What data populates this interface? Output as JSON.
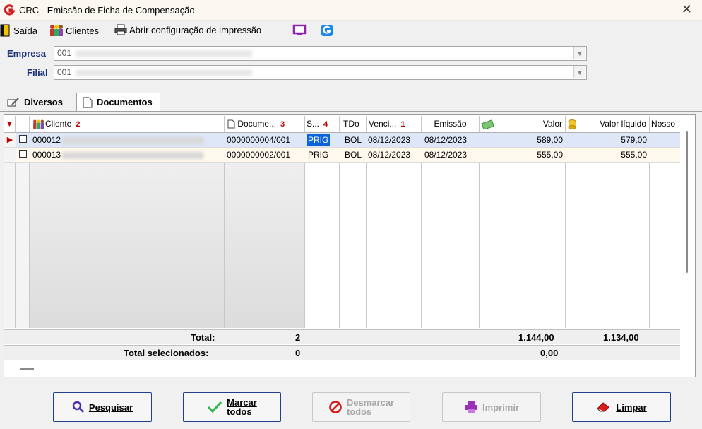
{
  "window": {
    "title": "CRC - Emissão de Ficha de Compensação",
    "close": "✕"
  },
  "menu": {
    "saida": "Saída",
    "clientes": "Clientes",
    "abrir": "Abrir configuração de impressão"
  },
  "form": {
    "empresa_label": "Empresa",
    "empresa_value": "001",
    "filial_label": "Filial",
    "filial_value": "001"
  },
  "tabs": {
    "diversos": "Diversos",
    "documentos": "Documentos"
  },
  "grid": {
    "headers": {
      "cliente": "Cliente",
      "cliente_sort": "2",
      "documento": "Docume...",
      "documento_sort": "3",
      "situacao": "S...",
      "situacao_sort": "4",
      "tdo": "TDo",
      "vencimento": "Venci...",
      "vencimento_sort": "1",
      "emissao": "Emissão",
      "valor": "Valor",
      "valor_liquido": "Valor líquido",
      "nosso": "Nosso"
    },
    "rows": [
      {
        "cliente": "000012",
        "documento": "0000000004/001",
        "situacao": "PRIG",
        "tdo": "BOL",
        "vencimento": "08/12/2023",
        "emissao": "08/12/2023",
        "valor": "589,00",
        "valor_liquido": "579,00"
      },
      {
        "cliente": "000013",
        "documento": "0000000002/001",
        "situacao": "PRIG",
        "tdo": "BOL",
        "vencimento": "08/12/2023",
        "emissao": "08/12/2023",
        "valor": "555,00",
        "valor_liquido": "555,00"
      }
    ],
    "totals": {
      "label": "Total:",
      "count": "2",
      "valor": "1.144,00",
      "valor_liquido": "1.134,00"
    },
    "selected": {
      "label": "Total selecionados:",
      "count": "0",
      "valor": "0,00"
    }
  },
  "buttons": {
    "pesquisar": "Pesquisar",
    "marcar_1": "Marcar",
    "marcar_2": "todos",
    "desmarcar_1": "Desmarcar",
    "desmarcar_2": "todos",
    "imprimir": "Imprimir",
    "limpar": "Limpar"
  },
  "colors": {
    "accent": "#1a2e7a",
    "selection": "#dde7f7",
    "row_alt": "#fff8ec",
    "sort_marker": "#c00000",
    "brand_red": "#d21f1f"
  }
}
